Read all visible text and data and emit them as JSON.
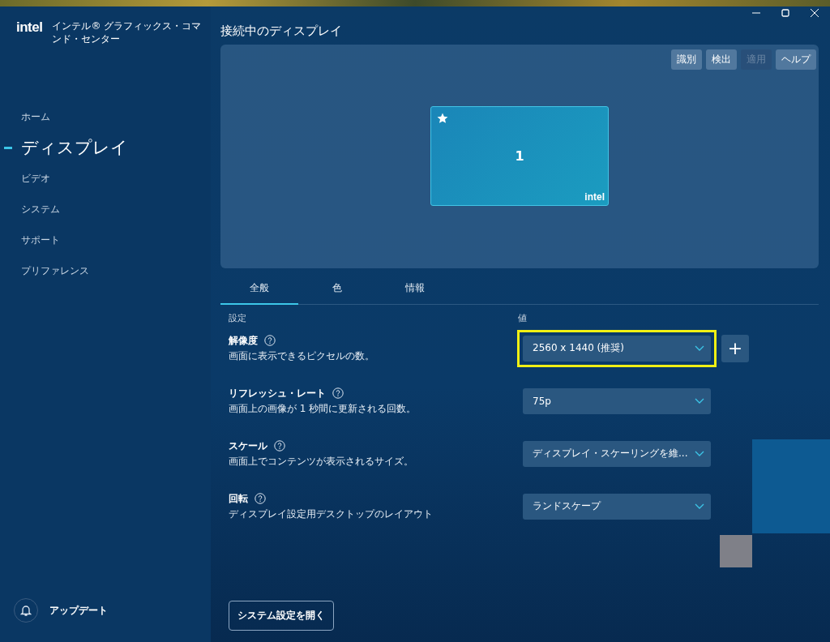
{
  "app": {
    "logo": "intel",
    "title": "インテル® グラフィックス・コマンド・センター"
  },
  "sidebar": {
    "items": [
      {
        "label": "ホーム",
        "selected": false
      },
      {
        "label": "ディスプレイ",
        "selected": true
      },
      {
        "label": "ビデオ",
        "selected": false
      },
      {
        "label": "システム",
        "selected": false
      },
      {
        "label": "サポート",
        "selected": false
      },
      {
        "label": "プリファレンス",
        "selected": false
      }
    ],
    "update": "アップデート"
  },
  "connected_displays": {
    "title": "接続中のディスプレイ",
    "buttons": [
      {
        "label": "識別",
        "disabled": false
      },
      {
        "label": "検出",
        "disabled": false
      },
      {
        "label": "適用",
        "disabled": true
      },
      {
        "label": "ヘルプ",
        "disabled": false
      }
    ],
    "display": {
      "number": "1",
      "primary": true,
      "logo": "intel"
    }
  },
  "tabs": [
    {
      "label": "全般",
      "selected": true
    },
    {
      "label": "色",
      "selected": false
    },
    {
      "label": "情報",
      "selected": false
    }
  ],
  "columns": [
    "設定",
    "値"
  ],
  "settings": [
    {
      "name": "解像度",
      "description": "画面に表示できるピクセルの数。",
      "value": "2560 x 1440 (推奨)",
      "highlighted": true,
      "add_button": "+"
    },
    {
      "name": "リフレッシュ・レート",
      "description": "画面上の画像が 1 秒間に更新される回数。",
      "value": "75p",
      "highlighted": false
    },
    {
      "name": "スケール",
      "description": "画面上でコンテンツが表示されるサイズ。",
      "value": "ディスプレイ・スケーリングを維...",
      "highlighted": false
    },
    {
      "name": "回転",
      "description": "ディスプレイ設定用デスクトップのレイアウト",
      "value": "ランドスケープ",
      "highlighted": false
    }
  ],
  "open_system_settings": "システム設定を開く"
}
